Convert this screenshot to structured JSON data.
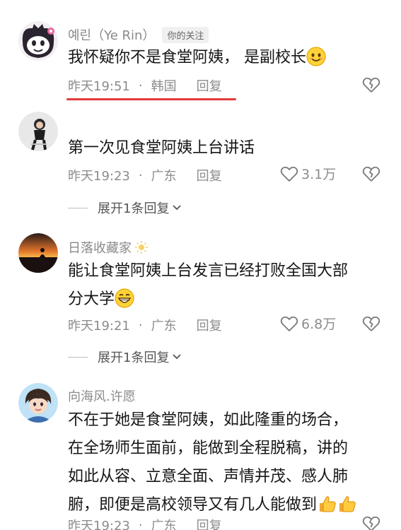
{
  "comments": [
    {
      "name": "예린（Ye Rin）",
      "tag": "你的关注",
      "text": "我怀疑你不是食堂阿姨， 是副校长",
      "time": "昨天19:51",
      "location": "韩国",
      "reply": "回复",
      "likes": ""
    },
    {
      "name": "",
      "text": "第一次见食堂阿姨上台讲话",
      "time": "昨天19:23",
      "location": "广东",
      "reply": "回复",
      "likes": "3.1万",
      "expand": "展开1条回复"
    },
    {
      "name": "日落收藏家",
      "text_line1": "能让食堂阿姨上台发言已经打败全国大部",
      "text_line2": "分大学",
      "time": "昨天19:21",
      "location": "广东",
      "reply": "回复",
      "likes": "6.8万",
      "expand": "展开1条回复"
    },
    {
      "name": "向海风.许愿",
      "text_line1": "不在于她是食堂阿姨，如此隆重的场合，",
      "text_line2": "在全场师生面前，能做到全程脱稿，讲的",
      "text_line3": "如此从容、立意全面、声情并茂、感人肺",
      "text_line4": "腑，即便是高校领导又有几人能做到",
      "time": "昨天19:23",
      "location": "广东",
      "reply": "回复"
    }
  ],
  "dot": "·",
  "icons": {
    "like": "heart-outline-icon",
    "dislike": "broken-heart-icon",
    "expand": "chevron-down-icon",
    "smile": "smiling-face-emoji",
    "grin": "grinning-face-emoji",
    "thumbs": "thumbs-up-emoji",
    "sun": "sun-icon"
  },
  "colors": {
    "meta_gray": "#8c8c8c",
    "underline_red": "#e23a3a",
    "tag_bg": "#f0f0f0"
  }
}
